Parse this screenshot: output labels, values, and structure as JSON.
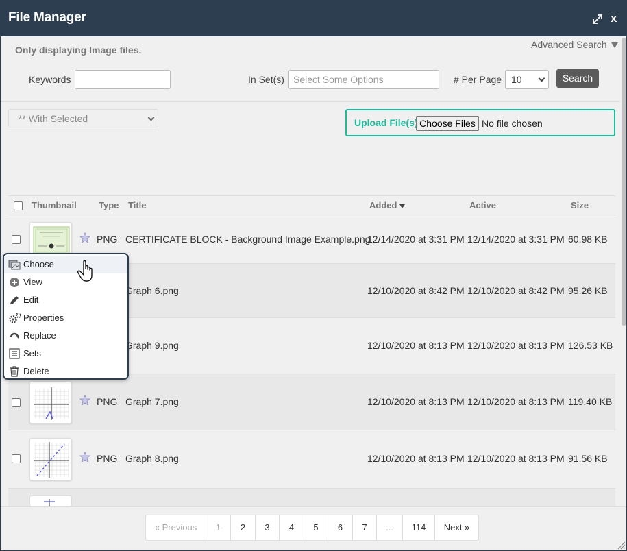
{
  "window": {
    "title": "File Manager",
    "close_label": "x"
  },
  "filter": {
    "note": "Only displaying Image files.",
    "advanced_search": "Advanced Search",
    "keywords_label": "Keywords",
    "keywords_value": "",
    "in_sets_label": "In Set(s)",
    "in_sets_placeholder": "Select Some Options",
    "per_page_label": "# Per Page",
    "per_page_value": "10",
    "search_button": "Search"
  },
  "bulk": {
    "with_selected": "** With Selected"
  },
  "upload": {
    "label": "Upload File(s)",
    "choose_button": "Choose Files",
    "status": "No file chosen"
  },
  "table": {
    "headers": {
      "thumbnail": "Thumbnail",
      "type": "Type",
      "title": "Title",
      "added": "Added",
      "active": "Active",
      "size": "Size"
    },
    "rows": [
      {
        "type": "PNG",
        "title": "CERTIFICATE BLOCK - Background Image Example.png",
        "added": "12/14/2020 at 3:31 PM",
        "active": "12/14/2020 at 3:31 PM",
        "size": "60.98 KB"
      },
      {
        "type": "",
        "title": "Graph 6.png",
        "added": "12/10/2020 at 8:42 PM",
        "active": "12/10/2020 at 8:42 PM",
        "size": "95.26 KB"
      },
      {
        "type": "",
        "title": "Graph 9.png",
        "added": "12/10/2020 at 8:13 PM",
        "active": "12/10/2020 at 8:13 PM",
        "size": "126.53 KB"
      },
      {
        "type": "PNG",
        "title": "Graph 7.png",
        "added": "12/10/2020 at 8:13 PM",
        "active": "12/10/2020 at 8:13 PM",
        "size": "119.40 KB"
      },
      {
        "type": "PNG",
        "title": "Graph 8.png",
        "added": "12/10/2020 at 8:13 PM",
        "active": "12/10/2020 at 8:13 PM",
        "size": "91.56 KB"
      }
    ]
  },
  "context_menu": {
    "items": [
      {
        "label": "Choose",
        "icon": "choose-icon"
      },
      {
        "label": "View",
        "icon": "view-icon"
      },
      {
        "label": "Edit",
        "icon": "pencil-icon"
      },
      {
        "label": "Properties",
        "icon": "gears-icon"
      },
      {
        "label": "Replace",
        "icon": "replace-icon"
      },
      {
        "label": "Sets",
        "icon": "list-icon"
      },
      {
        "label": "Delete",
        "icon": "trash-icon"
      }
    ]
  },
  "pagination": {
    "previous": "« Previous",
    "pages": [
      "1",
      "2",
      "3",
      "4",
      "5",
      "6",
      "7",
      "...",
      "114"
    ],
    "current": "1",
    "next": "Next »"
  },
  "colors": {
    "titlebar": "#2c3e50",
    "accent": "#1abc9c",
    "search_button": "#5a5a5a"
  }
}
